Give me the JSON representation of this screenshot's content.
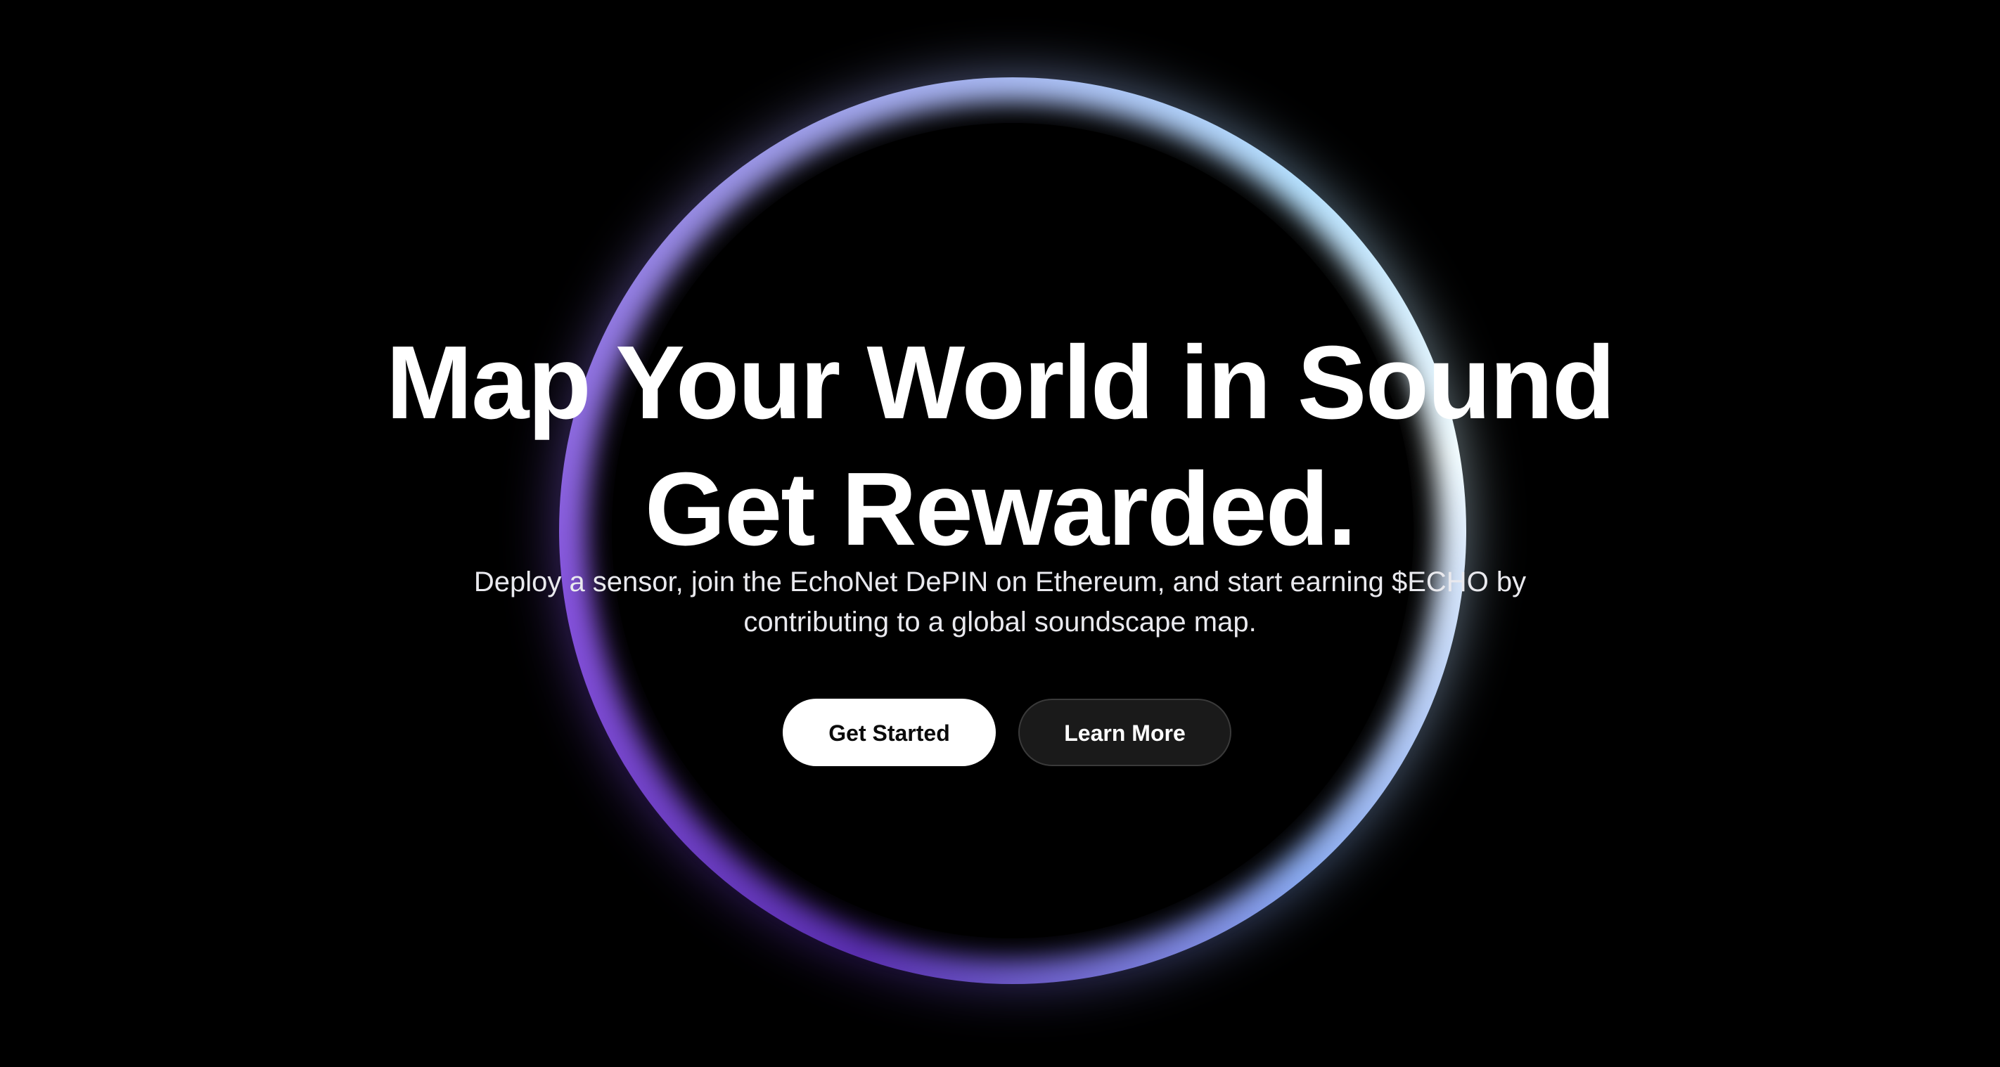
{
  "hero": {
    "headline_line1": "Map Your World in Sound",
    "headline_line2": "Get Rewarded.",
    "subtitle": "Deploy a sensor, join the EchoNet DePIN on Ethereum, and start earning $ECHO by contributing to a global soundscape map.",
    "primary_button": "Get Started",
    "secondary_button": "Learn More"
  },
  "colors": {
    "background": "#000000",
    "ring_purple": "#7a4bd6",
    "ring_blue": "#b7e2ff",
    "primary_button_bg": "#ffffff",
    "secondary_button_bg": "#1a1a1a"
  }
}
